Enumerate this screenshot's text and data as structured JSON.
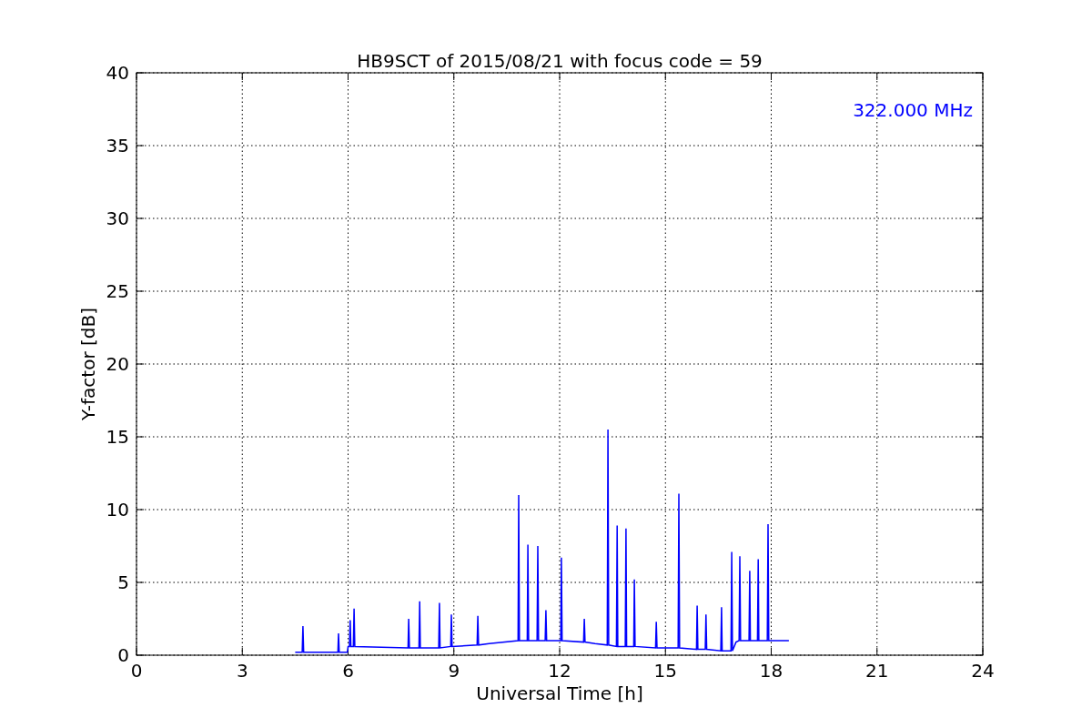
{
  "chart_data": {
    "type": "line",
    "title": "HB9SCT of 2015/08/21 with focus code = 59",
    "xlabel": "Universal Time [h]",
    "ylabel": "Y-factor [dB]",
    "xlim": [
      0,
      24
    ],
    "ylim": [
      0,
      40
    ],
    "xticks": [
      0,
      3,
      6,
      9,
      12,
      15,
      18,
      21,
      24
    ],
    "yticks": [
      0,
      5,
      10,
      15,
      20,
      25,
      30,
      35,
      40
    ],
    "x": [
      4.5,
      4.7,
      4.72,
      4.74,
      5.71,
      5.73,
      5.75,
      5.98,
      6.0,
      6.04,
      6.06,
      6.08,
      6.15,
      6.17,
      6.19,
      7.7,
      7.72,
      7.74,
      8.01,
      8.03,
      8.05,
      8.57,
      8.59,
      8.61,
      8.91,
      8.93,
      8.95,
      9.66,
      9.68,
      9.7,
      10.0,
      10.82,
      10.84,
      10.86,
      11.08,
      11.1,
      11.12,
      11.36,
      11.38,
      11.4,
      11.59,
      11.61,
      11.63,
      12.03,
      12.05,
      12.07,
      12.68,
      12.7,
      12.72,
      13.0,
      13.35,
      13.37,
      13.39,
      13.61,
      13.63,
      13.65,
      13.86,
      13.88,
      13.9,
      14.1,
      14.12,
      14.14,
      14.72,
      14.74,
      14.76,
      15.0,
      15.36,
      15.38,
      15.4,
      15.88,
      15.9,
      15.92,
      16.13,
      16.15,
      16.17,
      16.57,
      16.59,
      16.61,
      16.86,
      16.88,
      16.9,
      17.0,
      17.09,
      17.11,
      17.13,
      17.37,
      17.39,
      17.41,
      17.61,
      17.63,
      17.65,
      17.89,
      17.91,
      17.93,
      18.5
    ],
    "series": [
      {
        "name": "322.000 MHz",
        "color": "#0000ff",
        "values": [
          0.2,
          0.2,
          2.0,
          0.2,
          0.2,
          1.5,
          0.2,
          0.2,
          0.6,
          0.6,
          2.4,
          0.6,
          0.6,
          3.2,
          0.6,
          0.5,
          2.5,
          0.5,
          0.5,
          3.7,
          0.5,
          0.5,
          3.6,
          0.5,
          0.6,
          2.8,
          0.6,
          0.7,
          2.7,
          0.7,
          0.8,
          1.0,
          11.0,
          1.0,
          1.0,
          7.6,
          1.0,
          1.0,
          7.5,
          1.0,
          1.0,
          3.1,
          1.0,
          1.0,
          6.7,
          1.0,
          0.9,
          2.5,
          0.9,
          0.8,
          0.7,
          15.5,
          0.7,
          0.6,
          8.9,
          0.6,
          0.6,
          8.7,
          0.6,
          0.6,
          5.2,
          0.6,
          0.5,
          2.3,
          0.5,
          0.5,
          0.5,
          11.1,
          0.5,
          0.4,
          3.4,
          0.4,
          0.4,
          2.8,
          0.4,
          0.3,
          3.3,
          0.3,
          0.3,
          7.1,
          0.3,
          0.9,
          1.0,
          6.8,
          1.0,
          1.0,
          5.8,
          1.0,
          1.0,
          6.6,
          1.0,
          1.0,
          9.0,
          1.0,
          1.0
        ]
      }
    ],
    "grid": true
  }
}
